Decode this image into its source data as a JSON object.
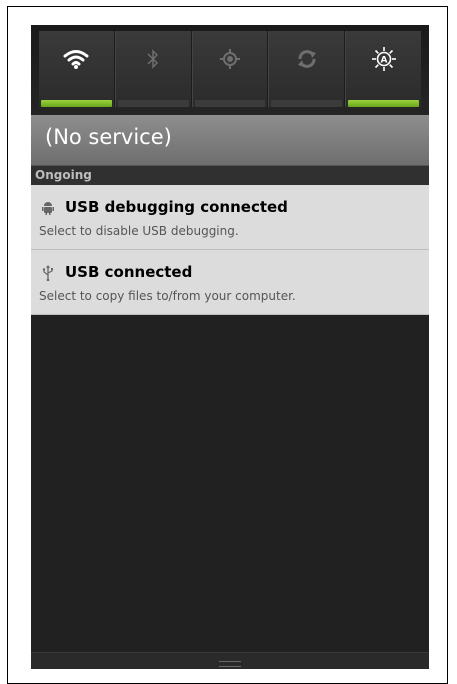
{
  "quick_settings": [
    {
      "name": "wifi-icon",
      "on": true
    },
    {
      "name": "bluetooth-icon",
      "on": false
    },
    {
      "name": "gps-icon",
      "on": false
    },
    {
      "name": "sync-icon",
      "on": false
    },
    {
      "name": "brightness-icon",
      "on": true
    }
  ],
  "carrier": {
    "label": "(No service)"
  },
  "section": {
    "label": "Ongoing"
  },
  "notifications": [
    {
      "icon": "android-icon",
      "title": "USB debugging connected",
      "subtitle": "Select to disable USB debugging."
    },
    {
      "icon": "usb-icon",
      "title": "USB connected",
      "subtitle": "Select to copy files to/from your computer."
    }
  ],
  "colors": {
    "accent_green": "#8cc63f",
    "panel_bg": "#212121",
    "notification_bg": "#dcdcdc"
  }
}
